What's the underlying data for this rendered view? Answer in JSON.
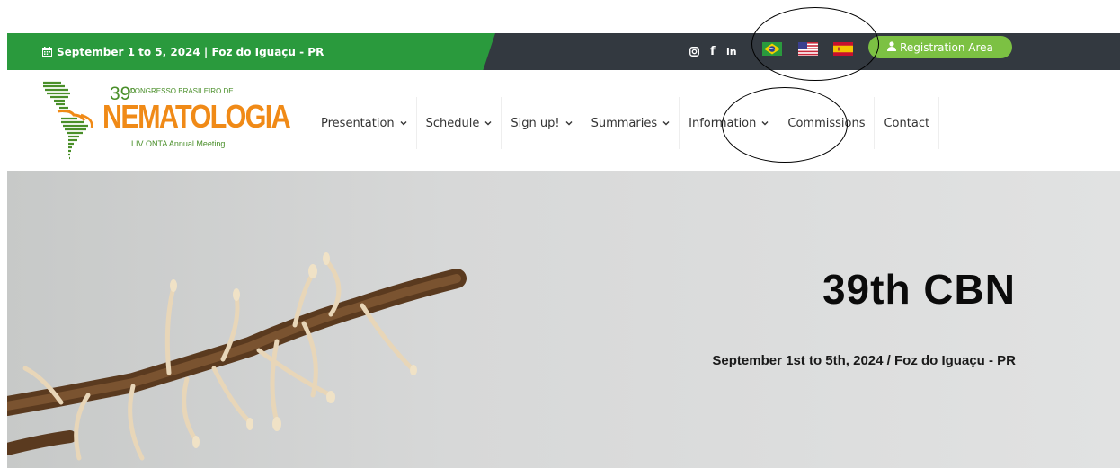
{
  "topbar": {
    "date_text": "September 1 to 5, 2024 | Foz do Iguaçu - PR",
    "social": [
      {
        "icon": "instagram-icon",
        "glyph": "◎"
      },
      {
        "icon": "facebook-icon",
        "glyph": "f"
      },
      {
        "icon": "linkedin-icon",
        "glyph": "in"
      }
    ],
    "languages": [
      "brazil-flag",
      "usa-flag",
      "spain-flag"
    ],
    "registration_label": "Registration Area"
  },
  "logo": {
    "number": "39",
    "ordinal": "o",
    "line1": "CONGRESSO BRASILEIRO DE",
    "line2": "NEMATOLOGIA",
    "line3": "LIV ONTA Annual Meeting"
  },
  "nav": {
    "items": [
      {
        "label": "Presentation",
        "dropdown": true
      },
      {
        "label": "Schedule",
        "dropdown": true
      },
      {
        "label": "Sign up!",
        "dropdown": true
      },
      {
        "label": "Summaries",
        "dropdown": true
      },
      {
        "label": "Information",
        "dropdown": true
      },
      {
        "label": "Commissions",
        "dropdown": false
      },
      {
        "label": "Contact",
        "dropdown": false
      }
    ]
  },
  "hero": {
    "title": "39th CBN",
    "subtitle": "September 1st to 5th, 2024 / Foz do Iguaçu - PR"
  },
  "colors": {
    "topbar_green": "#2a9a3d",
    "topbar_dark": "#333940",
    "registration_green": "#7cc143",
    "logo_orange": "#f08a17",
    "logo_green": "#4a8f2a"
  }
}
